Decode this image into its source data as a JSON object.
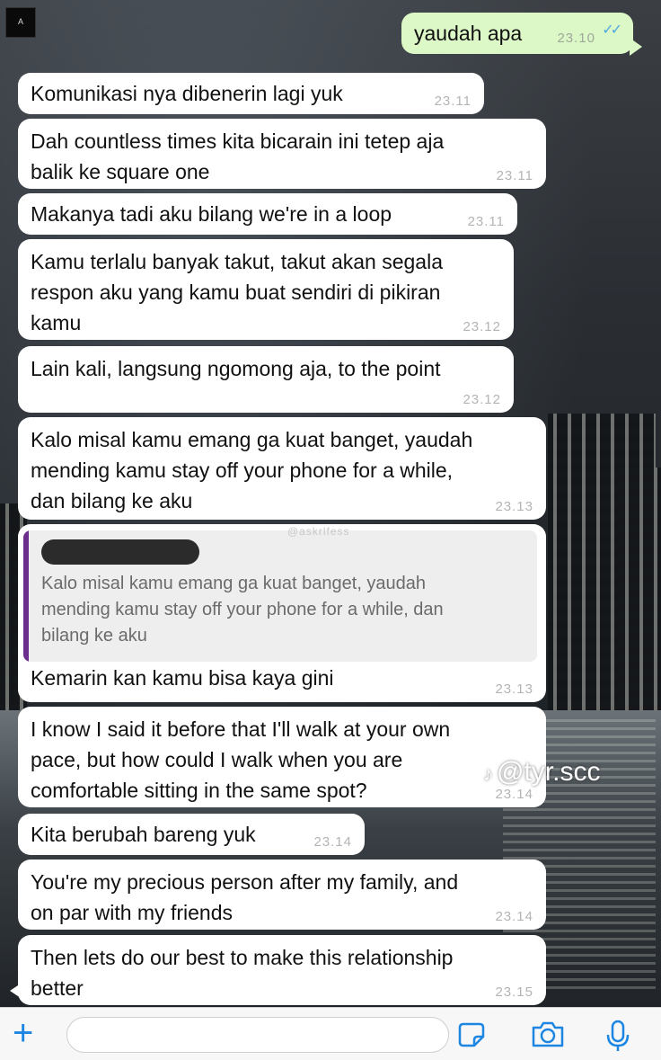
{
  "header": {
    "logo_text": "A"
  },
  "messages": [
    {
      "text": "yaudah apa",
      "time": "23.10",
      "sent": true,
      "ticks": "✓✓"
    },
    {
      "text": "Komunikasi nya dibenerin lagi yuk",
      "time": "23.11"
    },
    {
      "text": "Dah countless times kita bicarain ini tetep aja\nbalik ke square one",
      "time": "23.11"
    },
    {
      "text": "Makanya tadi aku bilang we're in a loop",
      "time": "23.11"
    },
    {
      "text": "Kamu terlalu banyak takut, takut akan segala\nrespon aku yang kamu buat sendiri di pikiran\nkamu",
      "time": "23.12"
    },
    {
      "text": "Lain kali, langsung ngomong aja, to the point",
      "time": "23.12"
    },
    {
      "text": "Kalo misal kamu emang ga kuat banget, yaudah\nmending kamu stay off your phone for a while,\ndan bilang ke aku",
      "time": "23.13"
    },
    {
      "text": "Kemarin kan kamu bisa kaya gini",
      "time": "23.13"
    },
    {
      "text": "I know I said it before that I'll walk at your own\npace, but how could I walk when you are\ncomfortable sitting in the same spot?",
      "time": "23.14"
    },
    {
      "text": "Kita berubah bareng yuk",
      "time": "23.14"
    },
    {
      "text": "You're my precious person after my family, and\non par with my friends",
      "time": "23.14"
    },
    {
      "text": "Then lets do our best to make this relationship\nbetter",
      "time": "23.15"
    }
  ],
  "quote": {
    "text": "Kalo misal kamu emang ga kuat banget, yaudah\nmending kamu stay off your phone for a while, dan\nbilang ke aku",
    "accent_color": "#6c2e8c"
  },
  "watermarks": {
    "small": "@askrlfess",
    "tiktok": "@tyr.scc"
  },
  "input_bar": {
    "icons": [
      "plus-icon",
      "sticker-icon",
      "camera-icon",
      "microphone-icon"
    ],
    "accent_color": "#1d86e2"
  }
}
